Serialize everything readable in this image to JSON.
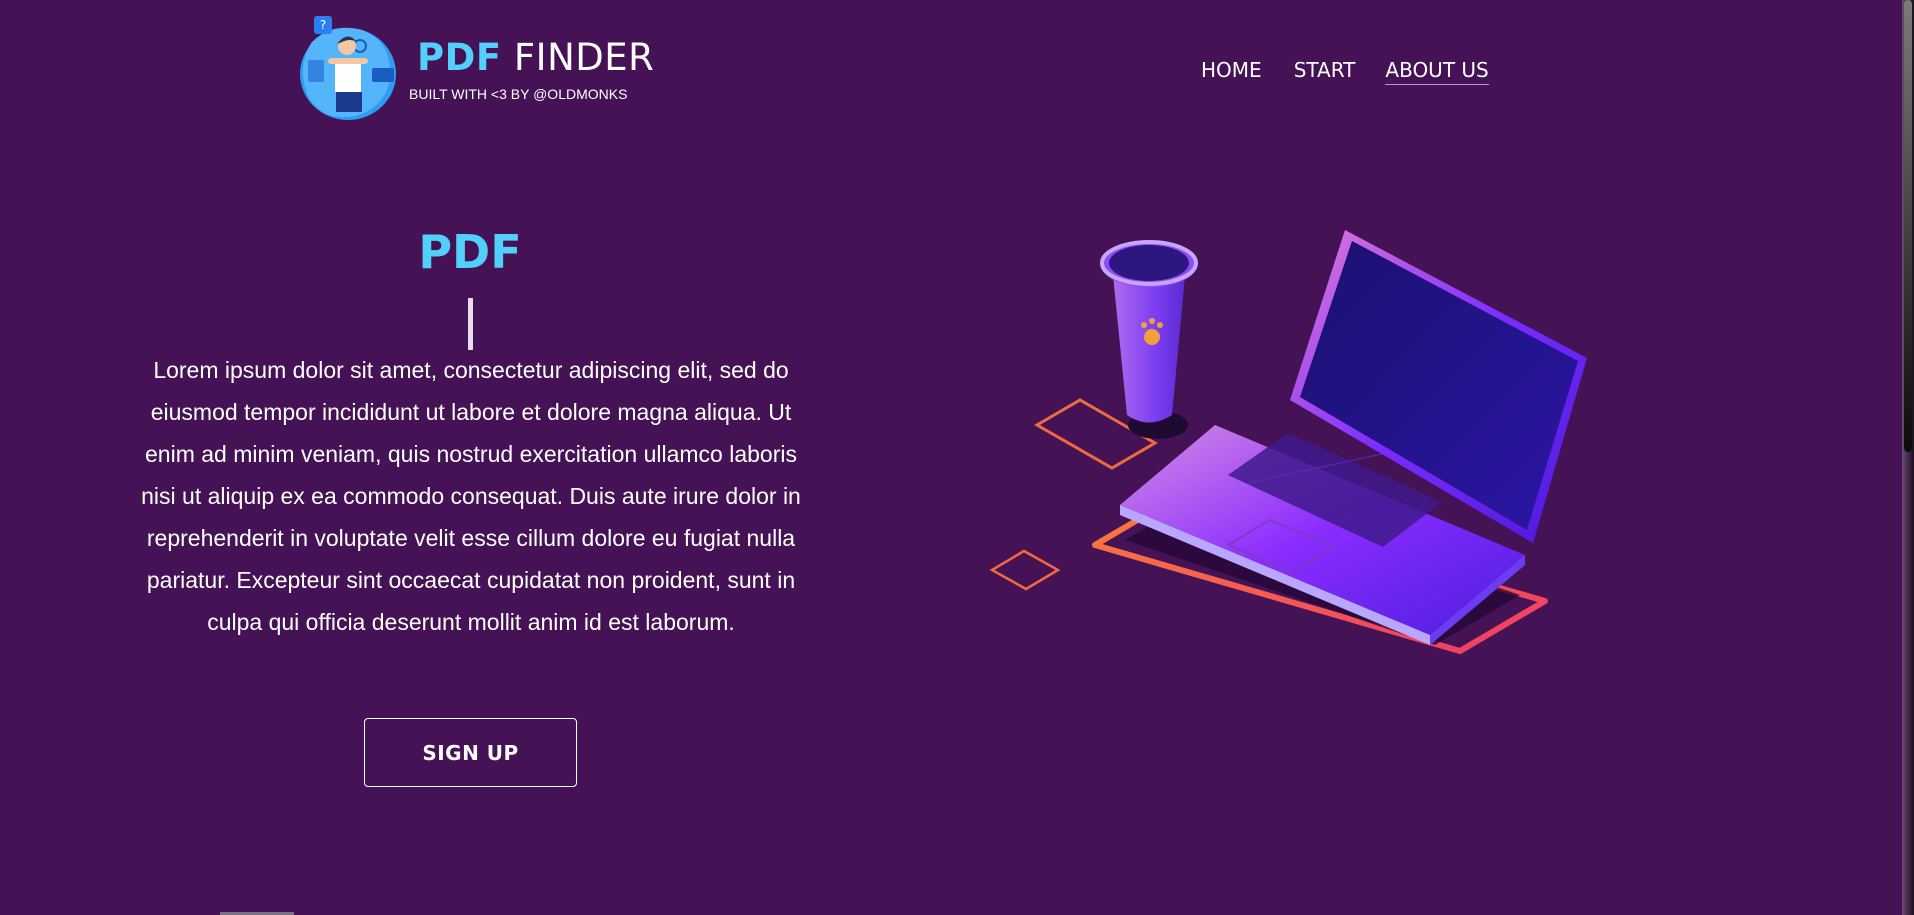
{
  "brand": {
    "title_accent": "PDF",
    "title_rest": " FINDER",
    "subtitle": "BUILT WITH <3 BY @OLDMONKS",
    "logo_badge": "?"
  },
  "nav": {
    "home": "HOME",
    "start": "START",
    "about": "ABOUT US"
  },
  "hero": {
    "title": "PDF",
    "paragraph": "Lorem ipsum dolor sit amet, consectetur adipiscing elit, sed do eiusmod tempor incididunt ut labore et dolore magna aliqua. Ut enim ad minim veniam, quis nostrud exercitation ullamco laboris nisi ut aliquip ex ea commodo consequat. Duis aute irure dolor in reprehenderit in voluptate velit esse cillum dolore eu fugiat nulla pariatur. Excepteur sint occaecat cupidatat non proident, sunt in culpa qui officia deserunt mollit anim id est laborum.",
    "signup_label": "SIGN UP"
  },
  "colors": {
    "background": "#451256",
    "accent": "#52d0fb"
  }
}
